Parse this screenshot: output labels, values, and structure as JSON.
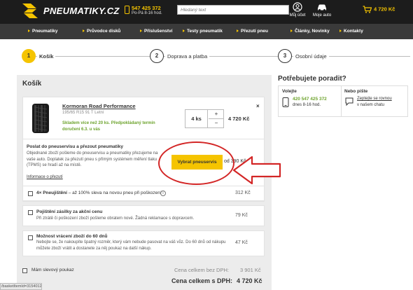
{
  "header": {
    "logo_text": "PNEUMATIKY.CZ",
    "phone": "547 425 372",
    "phone_hours": "Po-Pá 8-16 hod.",
    "search_placeholder": "Hledaný text",
    "account_label": "Můj účet",
    "car_label": "Moje auto",
    "cart_total": "4 720 Kč"
  },
  "nav": [
    "Pneumatiky",
    "Průvodce disků",
    "Příslušenství",
    "Testy pneumatik",
    "Přezutí pneu",
    "Články, Novinky",
    "Kontakty"
  ],
  "steps": [
    {
      "num": "1",
      "label": "Košík"
    },
    {
      "num": "2",
      "label": "Doprava a platba"
    },
    {
      "num": "3",
      "label": "Osobní údaje"
    }
  ],
  "cart": {
    "title": "Košík",
    "product": {
      "name": "Kormoran Road Performance",
      "spec": "195/65 R15 91 T Letní",
      "stock_line1": "Skladem více než 20 ks. Předpokládaný termín",
      "stock_line2": "doručení 6.3. u vás",
      "qty": "4 ks",
      "plus": "+",
      "minus": "−",
      "price": "4 720 Kč",
      "remove": "×"
    },
    "service": {
      "title": "Poslat do pneuservisu a přezout pneumatiky",
      "desc": "Objednané zboží pošleme do pneuservisu a pneumatiky přezujeme na vaše auto. Doplatek za přezutí pneu s přímým systémem měření tlaku (TPMS) se hradí až na místě.",
      "link": "Informace o přezutí",
      "button": "Vybrat pneuservis",
      "price_prefix": "od 390 Kč"
    },
    "options": [
      {
        "title_bold": "4× Pneujištění",
        "title_rest": " – až 100% sleva na novou pneu při poškození",
        "desc": "",
        "price": "312 Kč"
      },
      {
        "title_bold": "Pojištění zásilky za akční cenu",
        "title_rest": "",
        "desc": "Při ztrátě či poškození zboží pošleme obratem nové. Žádná reklamace s dopravcem.",
        "price": "79 Kč"
      },
      {
        "title_bold": "Možnost vrácení zboží do 60 dnů",
        "title_rest": "",
        "desc": "Nebojte se, že nakoupíte špatný rozměr, který vám nebude pasovat na váš vůz. Do 60 dnů od nákupu můžete zboží vrátit a dostanete za něj poukaz na další nákup.",
        "price": "47 Kč"
      }
    ],
    "discount_label": "Mám slevový poukaz",
    "total_no_vat_label": "Cena celkem bez DPH:",
    "total_no_vat": "3 901 Kč",
    "total_label": "Cena celkem s DPH:",
    "total": "4 720 Kč"
  },
  "help": {
    "title": "Potřebujete poradit?",
    "call_heading": "Volejte",
    "call_phone": "420 547 425 372",
    "call_hours": "dnes 8-16 hod.",
    "write_heading": "Nebo pište",
    "write_link": "Zeptejte se rovnou",
    "write_sub": "v našem chatu"
  },
  "status_bar": "/basketItemId=3154012",
  "colors": {
    "accent": "#f5c400",
    "dark": "#1c1c1c",
    "green": "#6da32d",
    "annotation": "#d32626"
  }
}
